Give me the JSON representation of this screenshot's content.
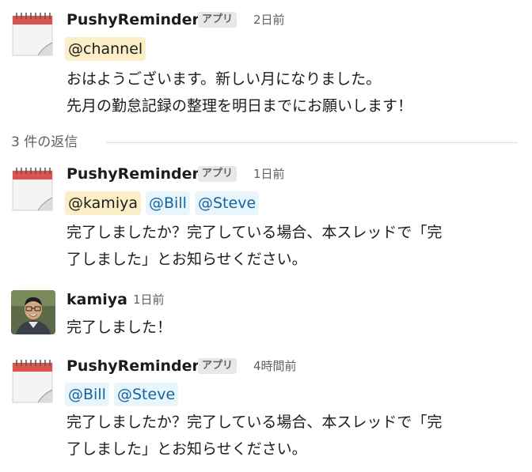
{
  "messages": [
    {
      "sender": "PushyReminder",
      "badge": "アプリ",
      "time": "2日前",
      "mentions": [
        "@channel"
      ],
      "lines": [
        "おはようございます。新しい月になりました。",
        "先月の勤怠記録の整理を明日までにお願いします！"
      ]
    },
    {
      "sender": "PushyReminder",
      "badge": "アプリ",
      "time": "1日前",
      "mentions": [
        "@kamiya",
        "@Bill",
        "@Steve"
      ],
      "lines": [
        "完了しましたか？完了している場合、本スレッドで「完",
        "了しました」とお知らせください。"
      ]
    },
    {
      "sender": "kamiya",
      "time": "1日前",
      "lines": [
        "完了しました！"
      ]
    },
    {
      "sender": "PushyReminder",
      "badge": "アプリ",
      "time": "4時間前",
      "mentions": [
        "@Bill",
        "@Steve"
      ],
      "lines": [
        "完了しましたか？完了している場合、本スレッドで「完",
        "了しました」とお知らせください。"
      ]
    }
  ],
  "replies_label": "3 件の返信",
  "icons": {
    "app_avatar": "calendar-icon",
    "user_avatar": "user-photo"
  },
  "colors": {
    "mention_highlight": "#fcefc7",
    "mention_user": "#e8f5fa",
    "mention_user_text": "#1264a3",
    "badge_bg": "#e8e8e8",
    "muted_text": "#616061"
  }
}
